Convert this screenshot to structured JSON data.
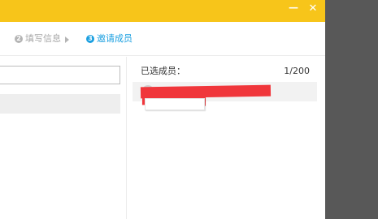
{
  "dialog": {
    "window_controls": {
      "minimize": "—",
      "close": "✕"
    },
    "steps": [
      {
        "number": "2",
        "label": "填写信息",
        "state": "done"
      },
      {
        "number": "3",
        "label": "邀请成员",
        "state": "active"
      }
    ],
    "search": {
      "value": "",
      "placeholder": ""
    },
    "selected": {
      "label": "已选成员：",
      "count": "1/200"
    }
  },
  "colors": {
    "titlebar": "#f7c51a",
    "active_step": "#1a9fe0",
    "inactive_step": "#a8a8a8",
    "redaction": "#f0363b"
  }
}
